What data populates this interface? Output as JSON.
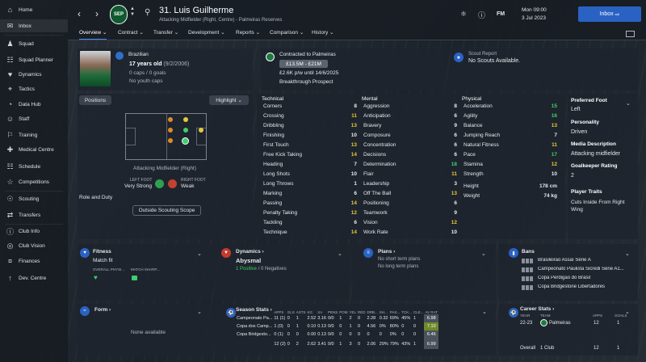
{
  "sidebar": {
    "items": [
      {
        "label": "Home",
        "icon": "home-icon"
      },
      {
        "label": "Inbox",
        "icon": "inbox-icon"
      },
      {
        "label": "Squad",
        "icon": "squad-icon"
      },
      {
        "label": "Squad Planner",
        "icon": "squad-planner-icon"
      },
      {
        "label": "Dynamics",
        "icon": "dynamics-icon"
      },
      {
        "label": "Tactics",
        "icon": "tactics-icon"
      },
      {
        "label": "Data Hub",
        "icon": "data-hub-icon"
      },
      {
        "label": "Staff",
        "icon": "staff-icon"
      },
      {
        "label": "Training",
        "icon": "training-icon"
      },
      {
        "label": "Medical Centre",
        "icon": "medical-icon"
      },
      {
        "label": "Schedule",
        "icon": "schedule-icon"
      },
      {
        "label": "Competitions",
        "icon": "trophy-icon"
      },
      {
        "label": "Scouting",
        "icon": "scouting-icon"
      },
      {
        "label": "Transfers",
        "icon": "transfers-icon"
      },
      {
        "label": "Club Info",
        "icon": "club-info-icon"
      },
      {
        "label": "Club Vision",
        "icon": "club-vision-icon"
      },
      {
        "label": "Finances",
        "icon": "finances-icon"
      },
      {
        "label": "Dev. Centre",
        "icon": "dev-centre-icon"
      }
    ]
  },
  "header": {
    "title": "31. Luis Guilherme",
    "subtitle": "Attacking Midfielder (Right, Centre) - Palmeiras Reserves",
    "crest_text": "SEP",
    "date_line1": "Mon 09:00",
    "date_line2": "3 Jul 2023",
    "inbox_label": "Inbox",
    "tabs": [
      "Overview",
      "Contract",
      "Transfer",
      "Development",
      "Reports",
      "Comparison",
      "History"
    ]
  },
  "profile": {
    "nationality": "Brazilian",
    "age": "17 years old",
    "dob": "(9/2/2006)",
    "caps": "0 caps / 0 goals",
    "youth": "No youth caps",
    "contract_label": "Contracted to Palmeiras",
    "value": "£13.5M - £21M",
    "wage": "£2.6K p/w until 14/6/2025",
    "breakthrough": "Breakthrough Prospect",
    "scout_label": "Scout Report",
    "scout_value": "No Scouts Available."
  },
  "positions": {
    "tab_label": "Positions",
    "highlight_label": "Highlight",
    "position_name": "Attacking Midfielder (Right)",
    "left_foot_label": "LEFT FOOT",
    "left_foot": "Very Strong",
    "right_foot_label": "RIGHT FOOT",
    "right_foot": "Weak",
    "role_duty": "Role and Duty",
    "scope_btn": "Outside Scouting Scope"
  },
  "attributes": {
    "technical_h": "Technical",
    "mental_h": "Mental",
    "physical_h": "Physical",
    "technical": [
      [
        "Corners",
        "8"
      ],
      [
        "Crossing",
        "11"
      ],
      [
        "Dribbling",
        "13"
      ],
      [
        "Finishing",
        "10"
      ],
      [
        "First Touch",
        "13"
      ],
      [
        "Free Kick Taking",
        "14"
      ],
      [
        "Heading",
        "7"
      ],
      [
        "Long Shots",
        "10"
      ],
      [
        "Long Throws",
        "1"
      ],
      [
        "Marking",
        "6"
      ],
      [
        "Passing",
        "14"
      ],
      [
        "Penalty Taking",
        "12"
      ],
      [
        "Tackling",
        "6"
      ],
      [
        "Technique",
        "14"
      ]
    ],
    "mental": [
      [
        "Aggression",
        "8"
      ],
      [
        "Anticipation",
        "6"
      ],
      [
        "Bravery",
        "9"
      ],
      [
        "Composure",
        "6"
      ],
      [
        "Concentration",
        "6"
      ],
      [
        "Decisions",
        "6"
      ],
      [
        "Determination",
        "18"
      ],
      [
        "Flair",
        "11"
      ],
      [
        "Leadership",
        "3"
      ],
      [
        "Off The Ball",
        "13"
      ],
      [
        "Positioning",
        "6"
      ],
      [
        "Teamwork",
        "9"
      ],
      [
        "Vision",
        "12"
      ],
      [
        "Work Rate",
        "10"
      ]
    ],
    "physical": [
      [
        "Acceleration",
        "15"
      ],
      [
        "Agility",
        "16"
      ],
      [
        "Balance",
        "13"
      ],
      [
        "Jumping Reach",
        "7"
      ],
      [
        "Natural Fitness",
        "11"
      ],
      [
        "Pace",
        "17"
      ],
      [
        "Stamina",
        "12"
      ],
      [
        "Strength",
        "10"
      ]
    ],
    "height_label": "Height",
    "height": "178 cm",
    "weight_label": "Weight",
    "weight": "74 kg"
  },
  "side": {
    "foot_h": "Preferred Foot",
    "foot": "Left",
    "personality_h": "Personality",
    "personality": "Driven",
    "media_h": "Media Description",
    "media": "Attacking midfielder",
    "gk_h": "Goalkeeper Rating",
    "gk": "2",
    "traits_h": "Player Traits",
    "traits": "Cuts Inside From Right Wing"
  },
  "fitness": {
    "title": "Fitness",
    "status": "Match fit",
    "col1": "OVERALL PHYSI...",
    "col2": "MATCH SHARP..."
  },
  "dynamics": {
    "title": "Dynamics",
    "value": "Abysmal",
    "positive": "1 Positive",
    "sep": "/",
    "negative": "0 Negatives"
  },
  "plans": {
    "title": "Plans",
    "short": "No short term plans",
    "long": "No long term plans"
  },
  "bans": {
    "title": "Bans",
    "items": [
      "Brasileirão Assaí Série A",
      "Campeonato Paulista Sicredi Série A1...",
      "Copa Perdigão do Brasil",
      "Copa Bridgestone Libertadores"
    ]
  },
  "form": {
    "title": "Form",
    "empty": "None available"
  },
  "season": {
    "title": "Season Stats",
    "headers": [
      "APPS",
      "GLS",
      "ASTS",
      "KG",
      "XA",
      "PENS",
      "POM",
      "YEL",
      "RED",
      "DRB...",
      "SH...",
      "PAS...",
      "TCK...",
      "CLE...",
      "AV RAT"
    ],
    "rows": [
      {
        "comp": "Campeonato Pa...",
        "cells": [
          "11 (1)",
          "0",
          "1",
          "2.52",
          "3.16",
          "0/0",
          "1",
          "2",
          "0",
          "2.28",
          "0.32",
          "69%",
          "45%",
          "1",
          "6.98"
        ]
      },
      {
        "comp": "Copa dos Camp...",
        "cells": [
          "1 (0)",
          "0",
          "1",
          "0.10",
          "0.13",
          "0/0",
          "0",
          "1",
          "0",
          "4.56",
          "0%",
          "80%",
          "0",
          "0",
          "7.10"
        ]
      },
      {
        "comp": "Copa Bridgesto...",
        "cells": [
          "0 (1)",
          "0",
          "0",
          "0.00",
          "0.13",
          "0/0",
          "0",
          "0",
          "0",
          "0",
          "0",
          "0%",
          "0",
          "0",
          "6.46"
        ]
      },
      {
        "comp": "",
        "cells": [
          "12 (2)",
          "0",
          "2",
          "2.62",
          "3.41",
          "0/0",
          "1",
          "3",
          "0",
          "2.06",
          "29%",
          "79%",
          "43%",
          "1",
          "6.99"
        ]
      }
    ]
  },
  "career": {
    "title": "Career Stats",
    "h_year": "YEAR",
    "h_team": "TEAM",
    "h_apps": "APPS",
    "h_goals": "GOALS",
    "year": "22-23",
    "team": "Palmeiras",
    "apps": "12",
    "goals": "1",
    "overall_label": "Overall",
    "overall_club": "1 Club",
    "overall_apps": "12",
    "overall_goals": "1"
  },
  "colors": {
    "accent": "#2a62c4",
    "green": "#3fcf6b",
    "yellow": "#e4c93b",
    "red": "#d94a3a"
  }
}
